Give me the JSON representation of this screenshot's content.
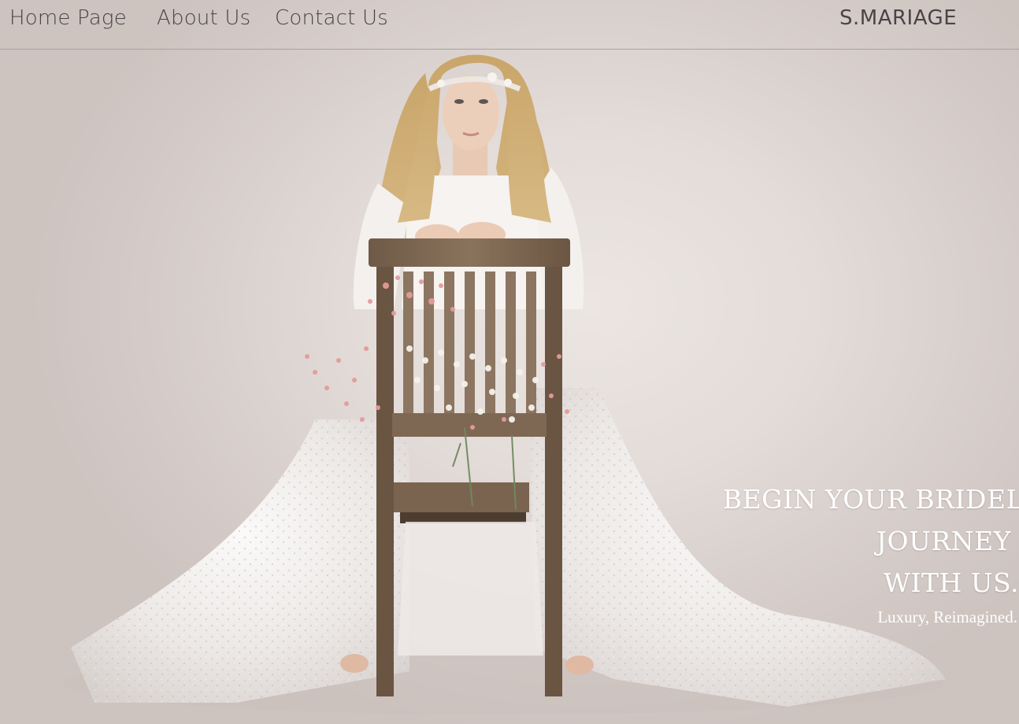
{
  "nav": {
    "links": [
      {
        "label": "Home Page"
      },
      {
        "label": "About Us"
      },
      {
        "label": "Contact Us"
      }
    ],
    "brand": "S.MARIAGE"
  },
  "hero": {
    "headline_lines": [
      "BEGIN YOUR BRIDEL",
      "JOURNEY",
      "WITH US."
    ],
    "tagline": "Luxury, Reimagined."
  },
  "colors": {
    "background": "#d9d1ce",
    "nav_text": "#4a4446",
    "hero_text": "#ffffff"
  }
}
